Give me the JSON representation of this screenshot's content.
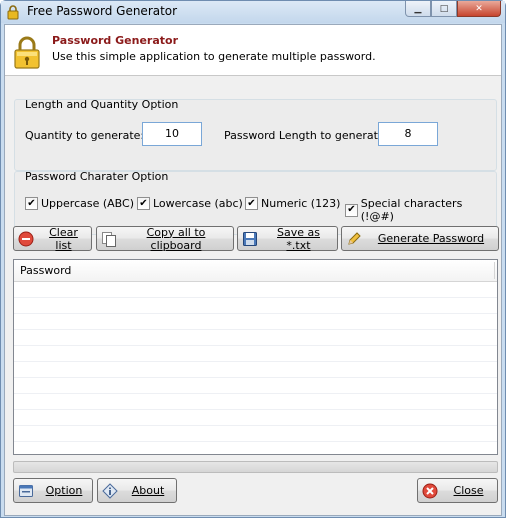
{
  "window": {
    "title": "Free Password Generator"
  },
  "header": {
    "title": "Password Generator",
    "subtitle": "Use this simple application to generate multiple password."
  },
  "length_group": {
    "title": "Length and Quantity Option",
    "quantity_label": "Quantity to generate:",
    "quantity_value": "10",
    "length_label": "Password Length to generate:",
    "length_value": "8"
  },
  "charset_group": {
    "title": "Password Charater Option",
    "options": [
      {
        "label": "Uppercase (ABC)",
        "checked": true
      },
      {
        "label": "Lowercase (abc)",
        "checked": true
      },
      {
        "label": "Numeric (123)",
        "checked": true
      },
      {
        "label": "Special characters (!@#)",
        "checked": true
      }
    ]
  },
  "toolbar": {
    "clear": "Clear list",
    "copy": "Copy all to clipboard",
    "save": "Save as *.txt",
    "generate": "Generate Password"
  },
  "list": {
    "column": "Password",
    "rows": []
  },
  "progress": {
    "value": 0
  },
  "footer": {
    "option": "Option",
    "about": "About",
    "close": "Close"
  },
  "icons": {
    "title": "lock-icon",
    "header": "lock-icon",
    "clear": "no-entry-icon",
    "copy": "copy-icon",
    "save": "save-icon",
    "generate": "pencil-icon",
    "option": "settings-icon",
    "about": "info-icon",
    "close": "close-icon"
  }
}
